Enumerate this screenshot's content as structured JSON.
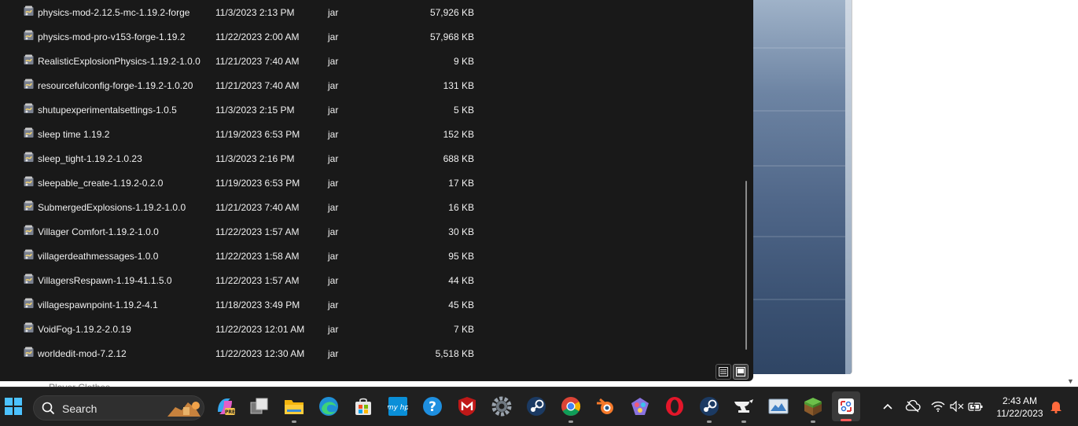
{
  "files": [
    {
      "name": "physics-mod-2.12.5-mc-1.19.2-forge",
      "date": "11/3/2023 2:13 PM",
      "type": "jar",
      "size": "57,926 KB"
    },
    {
      "name": "physics-mod-pro-v153-forge-1.19.2",
      "date": "11/22/2023 2:00 AM",
      "type": "jar",
      "size": "57,968 KB"
    },
    {
      "name": "RealisticExplosionPhysics-1.19.2-1.0.0",
      "date": "11/21/2023 7:40 AM",
      "type": "jar",
      "size": "9 KB"
    },
    {
      "name": "resourcefulconfig-forge-1.19.2-1.0.20",
      "date": "11/21/2023 7:40 AM",
      "type": "jar",
      "size": "131 KB"
    },
    {
      "name": "shutupexperimentalsettings-1.0.5",
      "date": "11/3/2023 2:15 PM",
      "type": "jar",
      "size": "5 KB"
    },
    {
      "name": "sleep time 1.19.2",
      "date": "11/19/2023 6:53 PM",
      "type": "jar",
      "size": "152 KB"
    },
    {
      "name": "sleep_tight-1.19.2-1.0.23",
      "date": "11/3/2023 2:16 PM",
      "type": "jar",
      "size": "688 KB"
    },
    {
      "name": "sleepable_create-1.19.2-0.2.0",
      "date": "11/19/2023 6:53 PM",
      "type": "jar",
      "size": "17 KB"
    },
    {
      "name": "SubmergedExplosions-1.19.2-1.0.0",
      "date": "11/21/2023 7:40 AM",
      "type": "jar",
      "size": "16 KB"
    },
    {
      "name": "Villager Comfort-1.19.2-1.0.0",
      "date": "11/22/2023 1:57 AM",
      "type": "jar",
      "size": "30 KB"
    },
    {
      "name": "villagerdeathmessages-1.0.0",
      "date": "11/22/2023 1:58 AM",
      "type": "jar",
      "size": "95 KB"
    },
    {
      "name": "VillagersRespawn-1.19-41.1.5.0",
      "date": "11/22/2023 1:57 AM",
      "type": "jar",
      "size": "44 KB"
    },
    {
      "name": "villagespawnpoint-1.19.2-4.1",
      "date": "11/18/2023 3:49 PM",
      "type": "jar",
      "size": "45 KB"
    },
    {
      "name": "VoidFog-1.19.2-2.0.19",
      "date": "11/22/2023 12:01 AM",
      "type": "jar",
      "size": "7 KB"
    },
    {
      "name": "worldedit-mod-7.2.12",
      "date": "11/22/2023 12:30 AM",
      "type": "jar",
      "size": "5,518 KB"
    }
  ],
  "behind_text": "Player Clothes",
  "taskbar": {
    "search_label": "Search",
    "pinned": [
      "copilot-icon",
      "task-view-icon",
      "file-explorer-icon",
      "edge-icon",
      "microsoft-store-icon",
      "myhp-icon",
      "help-icon",
      "mcafee-icon",
      "settings-icon",
      "steam-icon",
      "chrome-icon",
      "blender-icon",
      "paint-3d-icon",
      "opera-icon",
      "steam-icon-2",
      "curseforge-icon",
      "photos-icon",
      "minecraft-icon",
      "snipping-tool-icon"
    ]
  },
  "tray": {
    "time": "2:43 AM",
    "date": "11/22/2023"
  },
  "colors": {
    "explorer_bg": "#191919",
    "taskbar_bg": "#202020",
    "notification": "#ff6a3d"
  }
}
